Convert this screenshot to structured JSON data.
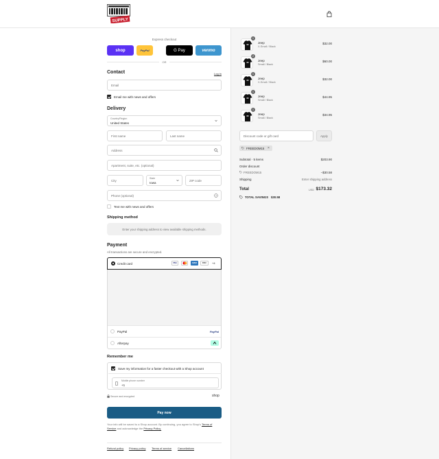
{
  "header": {
    "logo_text_top": "MOTOR DIRT",
    "logo_text_bottom": "SUPPLY"
  },
  "express": {
    "title": "Express checkout",
    "shop_label": "shop",
    "paypal_label": "PayPal",
    "gpay_label": "G Pay",
    "venmo_label": "venmo",
    "or_label": "OR"
  },
  "contact": {
    "title": "Contact",
    "login_link": "Log in",
    "email_placeholder": "Email",
    "news_label": "Email me with news and offers"
  },
  "delivery": {
    "title": "Delivery",
    "country_label": "Country/Region",
    "country_value": "United States",
    "first_name_placeholder": "First name",
    "last_name_placeholder": "Last name",
    "address_placeholder": "Address",
    "apartment_placeholder": "Apartment, suite, etc. (optional)",
    "city_placeholder": "City",
    "state_label": "State",
    "state_value": "Iowa",
    "zip_placeholder": "ZIP code",
    "phone_placeholder": "Phone (optional)",
    "text_news_label": "Text me with news and offers"
  },
  "shipping_method": {
    "title": "Shipping method",
    "notice": "Enter your shipping address to view available shipping methods."
  },
  "payment": {
    "title": "Payment",
    "subtitle": "All transactions are secure and encrypted.",
    "credit_card_label": "Credit card",
    "card_more": "+4",
    "paypal_label": "PayPal",
    "paypal_logo": "PayPal",
    "afterpay_label": "Afterpay"
  },
  "remember": {
    "title": "Remember me",
    "save_label": "Save my information for a faster checkout with a Shop account",
    "phone_label": "Mobile phone number",
    "phone_value": "+1",
    "secure_label": "Secure and encrypted",
    "shop_logo": "shop"
  },
  "pay_button": "Pay now",
  "terms": {
    "line1": "Your info will be saved to a Shop account. By continuing, you agree to Shop's",
    "tos": "Terms of Service",
    "and": "and acknowledge the",
    "privacy": "Privacy Policy."
  },
  "footer_links": [
    "Refund policy",
    "Privacy policy",
    "Terms of service",
    "Cancellations"
  ],
  "cart": {
    "items": [
      {
        "name": "Jeep",
        "variant": "X-Small / Black",
        "price": "$32.00",
        "qty": "1"
      },
      {
        "name": "Jeep",
        "variant": "Small / Black",
        "price": "$60.00",
        "qty": "2"
      },
      {
        "name": "Jeep",
        "variant": "X-Small / Black",
        "price": "$32.00",
        "qty": "1"
      },
      {
        "name": "Jeep",
        "variant": "Small / Black",
        "price": "$44.95",
        "qty": "1"
      },
      {
        "name": "Jeep",
        "variant": "Small / Black",
        "price": "$34.95",
        "qty": "1"
      }
    ],
    "discount_placeholder": "Discount code or gift card",
    "apply_label": "Apply",
    "code_chip": "FREEDOM15",
    "subtotal_label": "Subtotal · 5 items",
    "subtotal_value": "$203.90",
    "order_discount_label": "Order discount",
    "order_discount_code": "FREEDOM15",
    "order_discount_value": "−$30.58",
    "shipping_label": "Shipping",
    "shipping_value": "Enter shipping address",
    "total_label": "Total",
    "currency": "USD",
    "total_value": "$173.32",
    "savings_label": "TOTAL SAVINGS",
    "savings_value": "$30.58"
  },
  "colors": {
    "accent": "#1a5c85",
    "shop_purple": "#5a31f4",
    "paypal_yellow": "#ffc439",
    "venmo_blue": "#3d95ce",
    "logo_red": "#c8202f"
  }
}
